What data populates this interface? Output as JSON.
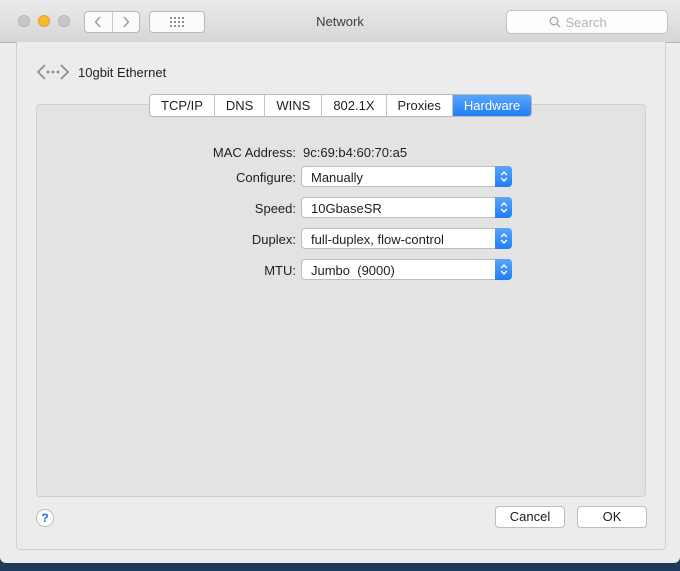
{
  "window": {
    "title": "Network"
  },
  "search": {
    "placeholder": "Search"
  },
  "interface": {
    "name": "10gbit Ethernet"
  },
  "tabs": [
    {
      "label": "TCP/IP",
      "active": false
    },
    {
      "label": "DNS",
      "active": false
    },
    {
      "label": "WINS",
      "active": false
    },
    {
      "label": "802.1X",
      "active": false
    },
    {
      "label": "Proxies",
      "active": false
    },
    {
      "label": "Hardware",
      "active": true
    }
  ],
  "hardware": {
    "mac_label": "MAC Address:",
    "mac_value": "9c:69:b4:60:70:a5",
    "configure_label": "Configure:",
    "configure_value": "Manually",
    "speed_label": "Speed:",
    "speed_value": "10GbaseSR",
    "duplex_label": "Duplex:",
    "duplex_value": "full-duplex, flow-control",
    "mtu_label": "MTU:",
    "mtu_value": "Jumbo  (9000)"
  },
  "footer": {
    "help_label": "?",
    "cancel_label": "Cancel",
    "ok_label": "OK"
  },
  "colors": {
    "accent": "#1f7ef5",
    "window_bg": "#ececec",
    "minimize_light": "#f6bd2e"
  }
}
